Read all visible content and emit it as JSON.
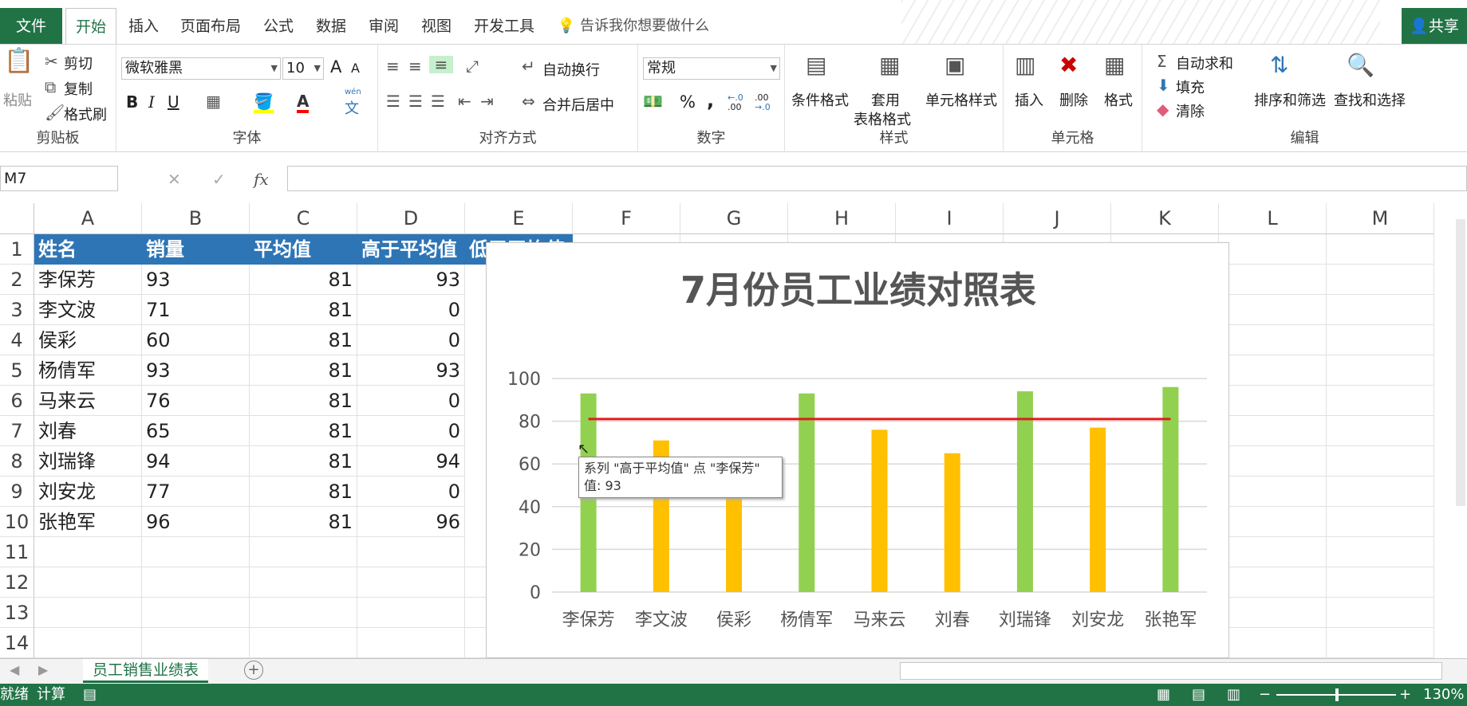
{
  "tabs": {
    "file": "文件",
    "items": [
      "开始",
      "插入",
      "页面布局",
      "公式",
      "数据",
      "审阅",
      "视图",
      "开发工具"
    ],
    "tell_me": "告诉我你想要做什么",
    "share": "共享"
  },
  "ribbon": {
    "clipboard": {
      "paste": "粘贴",
      "cut": "剪切",
      "copy": "复制",
      "format_painter": "格式刷",
      "label": "剪贴板"
    },
    "font": {
      "name": "微软雅黑",
      "size": "10",
      "label": "字体",
      "bold": "B",
      "italic": "I",
      "underline": "U",
      "grow": "A",
      "shrink": "A",
      "phonetic_top": "wén",
      "phonetic_bottom": "文"
    },
    "alignment": {
      "wrap": "自动换行",
      "merge": "合并后居中",
      "label": "对齐方式"
    },
    "number": {
      "format": "常规",
      "label": "数字",
      "percent": "%",
      "comma": ",",
      "inc_top": "←.0",
      "inc_bottom": ".00",
      "dec_top": ".00",
      "dec_bottom": "→.0"
    },
    "styles": {
      "conditional": "条件格式",
      "table_l1": "套用",
      "table_l2": "表格格式",
      "cell_styles": "单元格样式",
      "label": "样式"
    },
    "cells": {
      "insert": "插入",
      "delete": "删除",
      "format": "格式",
      "label": "单元格"
    },
    "editing": {
      "autosum": "自动求和",
      "fill": "填充",
      "clear": "清除",
      "sort": "排序和筛选",
      "find": "查找和选择",
      "label": "编辑"
    }
  },
  "formula_bar": {
    "name_box": "M7",
    "fx": "fx",
    "cancel": "✕",
    "enter": "✓",
    "value": ""
  },
  "columns": [
    "A",
    "B",
    "C",
    "D",
    "E",
    "F",
    "G",
    "H",
    "I",
    "J",
    "K",
    "L",
    "M"
  ],
  "rows": [
    "1",
    "2",
    "3",
    "4",
    "5",
    "6",
    "7",
    "8",
    "9",
    "10",
    "11",
    "12",
    "13",
    "14"
  ],
  "table": {
    "headers": [
      "姓名",
      "销量",
      "平均值",
      "高于平均值",
      "低于平均值"
    ],
    "data": [
      [
        "李保芳",
        "93",
        "81",
        "93"
      ],
      [
        "李文波",
        "71",
        "81",
        "0"
      ],
      [
        "侯彩",
        "60",
        "81",
        "0"
      ],
      [
        "杨倩军",
        "93",
        "81",
        "93"
      ],
      [
        "马来云",
        "76",
        "81",
        "0"
      ],
      [
        "刘春",
        "65",
        "81",
        "0"
      ],
      [
        "刘瑞锋",
        "94",
        "81",
        "94"
      ],
      [
        "刘安龙",
        "77",
        "81",
        "0"
      ],
      [
        "张艳军",
        "96",
        "81",
        "96"
      ]
    ]
  },
  "chart_data": {
    "type": "bar",
    "title": "7月份员工业绩对照表",
    "categories": [
      "李保芳",
      "李文波",
      "侯彩",
      "杨倩军",
      "马来云",
      "刘春",
      "刘瑞锋",
      "刘安龙",
      "张艳军"
    ],
    "series": [
      {
        "name": "高于平均值",
        "values": [
          93,
          0,
          0,
          93,
          0,
          0,
          94,
          0,
          96
        ],
        "color": "#92d050"
      },
      {
        "name": "低于平均值",
        "values": [
          0,
          71,
          60,
          0,
          76,
          65,
          0,
          77,
          0
        ],
        "color": "#ffc000"
      },
      {
        "name": "平均值",
        "type": "line",
        "values": [
          81,
          81,
          81,
          81,
          81,
          81,
          81,
          81,
          81
        ],
        "color": "#e31a1c"
      }
    ],
    "ylim": [
      0,
      100
    ],
    "yticks": [
      "0",
      "20",
      "40",
      "60",
      "80",
      "100"
    ],
    "grid": true,
    "tooltip": {
      "line1": "系列 \"高于平均值\" 点 \"李保芳\"",
      "line2": "值: 93"
    }
  },
  "sheet_tabs": {
    "active": "员工销售业绩表",
    "add": "+"
  },
  "status": {
    "ready": "就绪",
    "calc": "计算",
    "zoom": "130%"
  },
  "colors": {
    "excel_green": "#217346",
    "header_blue": "#2e75b6"
  }
}
